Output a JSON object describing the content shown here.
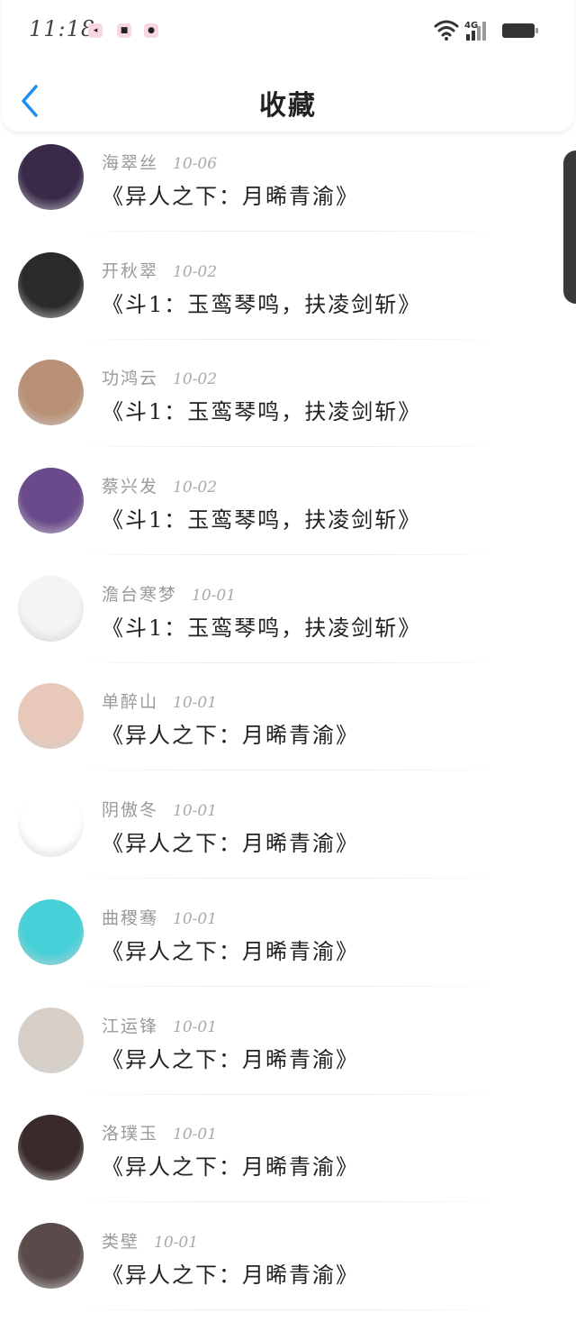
{
  "status_bar": {
    "time": "11:18",
    "notifications": [
      "notification-app-1-icon",
      "notification-app-2-icon",
      "notification-app-3-icon"
    ],
    "network": "4G"
  },
  "header": {
    "title": "收藏"
  },
  "colors": {
    "accent": "#1e8ff0",
    "text": "#222222",
    "meta": "#9a9a9a"
  },
  "items": [
    {
      "name": "海翠丝",
      "date": "10-06",
      "title": "《异人之下：月晞青渝》",
      "avatar": "#3a2a4a"
    },
    {
      "name": "开秋翠",
      "date": "10-02",
      "title": "《斗1：玉鸾琴鸣，扶凌剑斩》",
      "avatar": "#2b2b2b"
    },
    {
      "name": "功鸿云",
      "date": "10-02",
      "title": "《斗1：玉鸾琴鸣，扶凌剑斩》",
      "avatar": "#b89076"
    },
    {
      "name": "蔡兴发",
      "date": "10-02",
      "title": "《斗1：玉鸾琴鸣，扶凌剑斩》",
      "avatar": "#6a4a8a"
    },
    {
      "name": "澹台寒梦",
      "date": "10-01",
      "title": "《斗1：玉鸾琴鸣，扶凌剑斩》",
      "avatar": "#f4f4f4"
    },
    {
      "name": "单醉山",
      "date": "10-01",
      "title": "《异人之下：月晞青渝》",
      "avatar": "#e8c8b8"
    },
    {
      "name": "阴傲冬",
      "date": "10-01",
      "title": "《异人之下：月晞青渝》",
      "avatar": "#ffffff"
    },
    {
      "name": "曲稷骞",
      "date": "10-01",
      "title": "《异人之下：月晞青渝》",
      "avatar": "#48d0d8"
    },
    {
      "name": "江运锋",
      "date": "10-01",
      "title": "《异人之下：月晞青渝》",
      "avatar": "#d8d0c8"
    },
    {
      "name": "洛璞玉",
      "date": "10-01",
      "title": "《异人之下：月晞青渝》",
      "avatar": "#3a2a2a"
    },
    {
      "name": "类壁",
      "date": "10-01",
      "title": "《异人之下：月晞青渝》",
      "avatar": "#5a4a4a"
    }
  ]
}
